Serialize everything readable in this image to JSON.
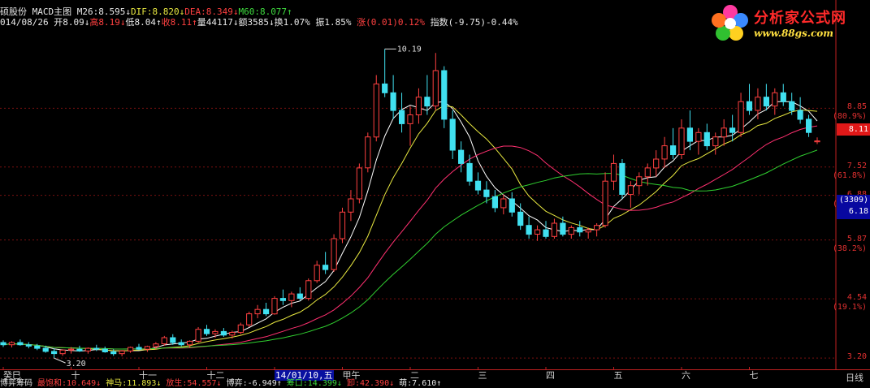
{
  "header": {
    "line1": [
      {
        "text": "硕股份",
        "c": "w"
      },
      {
        "text": " MACD主图 ",
        "c": "w"
      },
      {
        "text": "M26:8.595↓",
        "c": "w"
      },
      {
        "text": "DIF:8.820↓",
        "c": "y"
      },
      {
        "text": "DEA:8.349↓",
        "c": "r"
      },
      {
        "text": "M60:8.077↑",
        "c": "g"
      }
    ],
    "line2": [
      {
        "text": "014/08/26 ",
        "c": "w"
      },
      {
        "text": "开8.09↓",
        "c": "w"
      },
      {
        "text": "高8.19↓",
        "c": "r"
      },
      {
        "text": "低8.04↑",
        "c": "w"
      },
      {
        "text": "收8.11↑",
        "c": "r"
      },
      {
        "text": "量44117↓",
        "c": "w"
      },
      {
        "text": "额3585↓",
        "c": "w"
      },
      {
        "text": "换1.07%",
        "c": "w"
      },
      {
        "text": " 振1.85%",
        "c": "w"
      },
      {
        "text": " 涨(0.01)0.12%",
        "c": "r"
      },
      {
        "text": " 指数(-9.75)-0.44%",
        "c": "w"
      }
    ]
  },
  "logo": {
    "name": "分析家公式网",
    "url": "www.88gs.com",
    "icon": "flower-logo-icon"
  },
  "price_tag": "8.11",
  "cursor_box": {
    "count": "(3309)",
    "price": "6.18"
  },
  "right_axis": [
    {
      "value": "8.85",
      "pct": "(80.9%)"
    },
    {
      "value": "7.52",
      "pct": "(61.8%)"
    },
    {
      "value": "6.88",
      "pct": "(50.0%)"
    },
    {
      "value": "5.87",
      "pct": "(38.2%)"
    },
    {
      "value": "4.54",
      "pct": "(19.1%)"
    },
    {
      "value": "3.20",
      "pct": ""
    }
  ],
  "x_axis": {
    "labels": [
      "癸巳",
      "十",
      "十一",
      "十二",
      "14/01/10,五",
      "甲午",
      "二",
      "三",
      "四",
      "五",
      "六",
      "七"
    ],
    "selected_index": 4,
    "right_label": "日线"
  },
  "bottom_bar": [
    {
      "text": "博弈筹码",
      "c": "w"
    },
    {
      "text": "  最饱和:10.649↓",
      "c": "r"
    },
    {
      "text": "  神马:11.893↓",
      "c": "y"
    },
    {
      "text": "  放生:54.557↓",
      "c": "r"
    },
    {
      "text": "  博弈:-6.949↑",
      "c": "w"
    },
    {
      "text": "  筹口:14.399↓",
      "c": "g"
    },
    {
      "text": "  卸:42.390↓",
      "c": "r"
    },
    {
      "text": "  萌:7.610↑",
      "c": "w"
    }
  ],
  "chart_data": {
    "type": "candlestick",
    "title": "MACD主图",
    "ylim": [
      3.0,
      10.6
    ],
    "y_ticks": [
      3.2,
      4.54,
      5.87,
      6.88,
      7.52,
      8.85
    ],
    "annotations": [
      {
        "label": "10.19",
        "x": "三",
        "note": "high"
      },
      {
        "label": "3.20",
        "x": "十",
        "note": "low"
      }
    ],
    "colors": {
      "up": "#ff4040",
      "down": "#40e0f0",
      "ma1": "#ffffff",
      "ma2": "#e8e840",
      "ma3": "#ff3070",
      "ma4": "#30d030",
      "grid": "#7a1010"
    },
    "candles": [
      [
        3.55,
        3.6,
        3.45,
        3.5
      ],
      [
        3.5,
        3.58,
        3.44,
        3.55
      ],
      [
        3.55,
        3.62,
        3.48,
        3.5
      ],
      [
        3.5,
        3.56,
        3.42,
        3.47
      ],
      [
        3.47,
        3.52,
        3.38,
        3.42
      ],
      [
        3.42,
        3.48,
        3.32,
        3.35
      ],
      [
        3.35,
        3.42,
        3.2,
        3.3
      ],
      [
        3.3,
        3.4,
        3.25,
        3.38
      ],
      [
        3.38,
        3.45,
        3.3,
        3.4
      ],
      [
        3.4,
        3.48,
        3.34,
        3.36
      ],
      [
        3.36,
        3.44,
        3.3,
        3.42
      ],
      [
        3.42,
        3.5,
        3.36,
        3.4
      ],
      [
        3.4,
        3.46,
        3.32,
        3.34
      ],
      [
        3.34,
        3.4,
        3.25,
        3.3
      ],
      [
        3.3,
        3.38,
        3.24,
        3.36
      ],
      [
        3.36,
        3.46,
        3.32,
        3.44
      ],
      [
        3.44,
        3.52,
        3.38,
        3.4
      ],
      [
        3.4,
        3.48,
        3.34,
        3.46
      ],
      [
        3.46,
        3.56,
        3.4,
        3.52
      ],
      [
        3.52,
        3.7,
        3.48,
        3.66
      ],
      [
        3.66,
        3.74,
        3.5,
        3.55
      ],
      [
        3.55,
        3.62,
        3.46,
        3.5
      ],
      [
        3.5,
        3.6,
        3.44,
        3.58
      ],
      [
        3.58,
        3.9,
        3.55,
        3.85
      ],
      [
        3.85,
        3.95,
        3.7,
        3.75
      ],
      [
        3.75,
        3.85,
        3.66,
        3.8
      ],
      [
        3.8,
        3.88,
        3.68,
        3.72
      ],
      [
        3.72,
        3.82,
        3.64,
        3.78
      ],
      [
        3.78,
        4.0,
        3.74,
        3.95
      ],
      [
        3.95,
        4.25,
        3.9,
        4.2
      ],
      [
        4.2,
        4.4,
        4.1,
        4.3
      ],
      [
        4.3,
        4.45,
        4.15,
        4.2
      ],
      [
        4.2,
        4.6,
        4.18,
        4.55
      ],
      [
        4.55,
        4.75,
        4.4,
        4.5
      ],
      [
        4.5,
        4.7,
        4.35,
        4.65
      ],
      [
        4.65,
        4.8,
        4.5,
        4.55
      ],
      [
        4.55,
        5.0,
        4.5,
        4.95
      ],
      [
        4.95,
        5.4,
        4.9,
        5.3
      ],
      [
        5.3,
        5.6,
        5.1,
        5.2
      ],
      [
        5.2,
        6.0,
        5.15,
        5.9
      ],
      [
        5.9,
        6.6,
        5.8,
        6.5
      ],
      [
        6.5,
        7.0,
        6.3,
        6.8
      ],
      [
        6.8,
        7.6,
        6.7,
        7.5
      ],
      [
        7.5,
        8.3,
        7.4,
        8.2
      ],
      [
        8.2,
        9.6,
        8.1,
        9.4
      ],
      [
        9.4,
        10.19,
        9.1,
        9.2
      ],
      [
        9.2,
        9.6,
        8.6,
        8.8
      ],
      [
        8.8,
        9.2,
        8.3,
        8.5
      ],
      [
        8.5,
        8.9,
        8.0,
        8.7
      ],
      [
        8.7,
        9.3,
        8.5,
        9.1
      ],
      [
        9.1,
        9.6,
        8.7,
        8.9
      ],
      [
        8.9,
        10.1,
        8.8,
        9.7
      ],
      [
        9.7,
        9.8,
        8.4,
        8.6
      ],
      [
        8.6,
        8.8,
        7.7,
        7.9
      ],
      [
        7.9,
        8.1,
        7.4,
        7.6
      ],
      [
        7.6,
        7.8,
        7.1,
        7.2
      ],
      [
        7.2,
        7.4,
        6.9,
        7.0
      ],
      [
        7.0,
        7.2,
        6.7,
        6.85
      ],
      [
        6.85,
        7.0,
        6.5,
        6.6
      ],
      [
        6.6,
        6.9,
        6.45,
        6.8
      ],
      [
        6.8,
        6.95,
        6.4,
        6.5
      ],
      [
        6.5,
        6.7,
        6.1,
        6.2
      ],
      [
        6.2,
        6.4,
        5.9,
        6.0
      ],
      [
        6.0,
        6.2,
        5.85,
        6.1
      ],
      [
        6.1,
        6.3,
        5.9,
        5.95
      ],
      [
        5.95,
        6.35,
        5.9,
        6.25
      ],
      [
        6.25,
        6.4,
        5.95,
        6.0
      ],
      [
        6.0,
        6.2,
        5.9,
        6.15
      ],
      [
        6.15,
        6.3,
        5.95,
        6.05
      ],
      [
        6.05,
        6.15,
        5.9,
        6.1
      ],
      [
        6.1,
        6.25,
        5.95,
        6.2
      ],
      [
        6.2,
        7.4,
        6.15,
        7.2
      ],
      [
        7.2,
        7.8,
        7.0,
        7.6
      ],
      [
        7.6,
        7.7,
        6.8,
        6.9
      ],
      [
        6.9,
        7.2,
        6.6,
        7.1
      ],
      [
        7.1,
        7.4,
        6.9,
        7.3
      ],
      [
        7.3,
        7.6,
        7.1,
        7.5
      ],
      [
        7.5,
        7.9,
        7.3,
        7.7
      ],
      [
        7.7,
        8.2,
        7.5,
        8.0
      ],
      [
        8.0,
        8.4,
        7.7,
        7.8
      ],
      [
        7.8,
        8.6,
        7.7,
        8.4
      ],
      [
        8.4,
        8.8,
        7.9,
        8.1
      ],
      [
        8.1,
        8.4,
        7.8,
        8.3
      ],
      [
        8.3,
        8.5,
        7.9,
        8.0
      ],
      [
        8.0,
        8.3,
        7.8,
        8.2
      ],
      [
        8.2,
        8.6,
        8.0,
        8.4
      ],
      [
        8.4,
        8.7,
        8.1,
        8.3
      ],
      [
        8.3,
        9.2,
        8.2,
        9.0
      ],
      [
        9.0,
        9.4,
        8.7,
        8.8
      ],
      [
        8.8,
        9.3,
        8.6,
        9.1
      ],
      [
        9.1,
        9.4,
        8.8,
        8.9
      ],
      [
        8.9,
        9.3,
        8.7,
        9.2
      ],
      [
        9.2,
        9.4,
        8.9,
        9.0
      ],
      [
        9.0,
        9.2,
        8.7,
        8.8
      ],
      [
        8.8,
        9.1,
        8.5,
        8.6
      ],
      [
        8.6,
        8.7,
        8.2,
        8.3
      ],
      [
        8.09,
        8.19,
        8.04,
        8.11
      ]
    ]
  }
}
